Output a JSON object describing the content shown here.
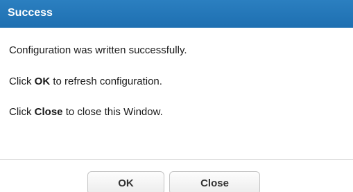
{
  "dialog": {
    "title": "Success",
    "titlebar_color": "#2677ba",
    "message": "Configuration was written successfully.",
    "ok_instruction": {
      "prefix": "Click",
      "key": "OK",
      "suffix": "to refresh configuration."
    },
    "close_instruction": {
      "prefix": "Click",
      "key": "Close",
      "suffix": "to close this Window."
    },
    "buttons": {
      "ok_label": "OK",
      "close_label": "Close"
    }
  }
}
